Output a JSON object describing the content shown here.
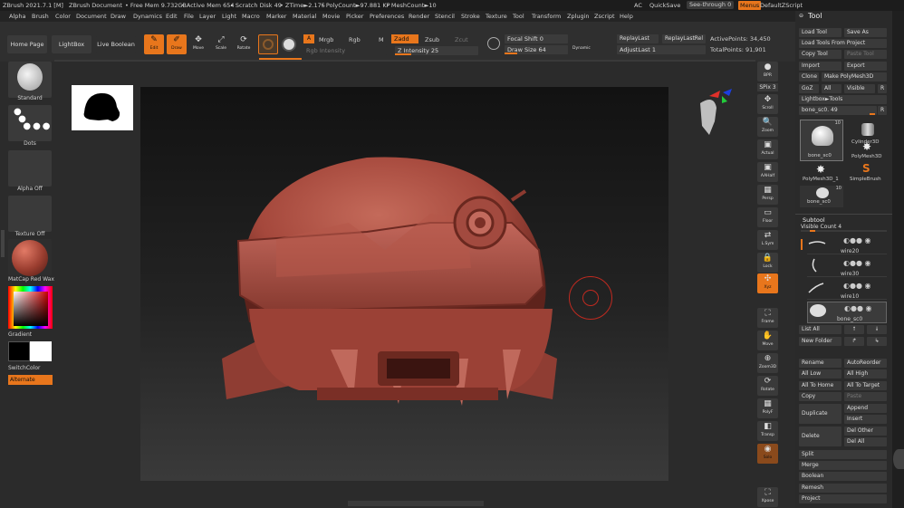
{
  "menubar": {
    "app_title": "ZBrush 2021.7.1 [M]",
    "document": "ZBrush Document",
    "stats": [
      "• Free Mem 9.732GB",
      "• Active Mem 654",
      "• Scratch Disk 49",
      "• ZTime►2.175",
      "• PolyCount►97.881 KP",
      "• MeshCount►10"
    ],
    "ac": "AC",
    "quicksave": "QuickSave",
    "seethrough": "See-through  0",
    "menus": "Menus",
    "script": "DefaultZScript",
    "items": [
      "Alpha",
      "Brush",
      "Color",
      "Document",
      "Draw",
      "Dynamics",
      "Edit",
      "File",
      "Layer",
      "Light",
      "Macro",
      "Marker",
      "Material",
      "Movie",
      "Picker",
      "Preferences",
      "Render",
      "Stencil",
      "Stroke",
      "Texture",
      "Tool",
      "Transform",
      "Zplugin",
      "Zscript",
      "Help"
    ]
  },
  "shelf": {
    "home_page": "Home Page",
    "lightbox": "LightBox",
    "live_boolean": "Live Boolean",
    "tools": [
      {
        "label": "Edit",
        "glyph": "✎",
        "active": true
      },
      {
        "label": "Draw",
        "glyph": "✐",
        "active": true
      },
      {
        "label": "Move",
        "glyph": "✥",
        "active": false
      },
      {
        "label": "Scale",
        "glyph": "⤢",
        "active": false
      },
      {
        "label": "Rotate",
        "glyph": "⟳",
        "active": false
      }
    ],
    "a_btn": "A",
    "mrgb": "Mrgb",
    "rgb": "Rgb",
    "m": "M",
    "rgb_intensity": "Rgb Intensity",
    "zadd": "Zadd",
    "zsub": "Zsub",
    "zcut": "Zcut",
    "z_intensity": "Z Intensity 25",
    "focal_shift": "Focal Shift 0",
    "draw_size": "Draw Size 64",
    "dynamic": "Dynamic",
    "replay_last": "ReplayLast",
    "replay_last_rel": "ReplayLastRel",
    "adjust_last": "AdjustLast  1",
    "active_points": "ActivePoints: 34,450",
    "total_points": "TotalPoints: 91,901"
  },
  "leftshelf": {
    "brush": "Standard",
    "stroke": "Dots",
    "alpha": "Alpha Off",
    "texture": "Texture Off",
    "material": "MatCap Red Wax",
    "gradient": "Gradient",
    "switchcolor": "SwitchColor",
    "alternate": "Alternate"
  },
  "rightshelf": [
    {
      "label": "BPR",
      "glyph": "●"
    },
    {
      "label": "SPix 3",
      "glyph": ""
    },
    {
      "label": "Scroll",
      "glyph": "✥"
    },
    {
      "label": "Zoom",
      "glyph": "🔍"
    },
    {
      "label": "Actual",
      "glyph": "▣"
    },
    {
      "label": "AAHalf",
      "glyph": "▣"
    },
    {
      "label": "Persp",
      "glyph": "▦"
    },
    {
      "label": "Floor",
      "glyph": "▭"
    },
    {
      "label": "L.Sym",
      "glyph": "⇄"
    },
    {
      "label": "Lock",
      "glyph": "🔒"
    },
    {
      "label": "Xyz",
      "glyph": "✣"
    },
    {
      "label": "Frame",
      "glyph": "⛶"
    },
    {
      "label": "Move",
      "glyph": "✋"
    },
    {
      "label": "Zoom3D",
      "glyph": "⊕"
    },
    {
      "label": "Rotate",
      "glyph": "⟳"
    },
    {
      "label": "PolyF",
      "glyph": "▦"
    },
    {
      "label": "Transp",
      "glyph": "◧"
    },
    {
      "label": "Solo",
      "glyph": "◉"
    },
    {
      "label": "Xpose",
      "glyph": "⛶"
    }
  ],
  "tool": {
    "title": "Tool",
    "load_tool": "Load Tool",
    "save_as": "Save As",
    "load_from_project": "Load Tools From Project",
    "copy_tool": "Copy Tool",
    "paste_tool": "Paste Tool",
    "import": "Import",
    "export": "Export",
    "clone": "Clone",
    "make_polymesh": "Make PolyMesh3D",
    "goz": "GoZ",
    "all": "All",
    "visible": "Visible",
    "r": "R",
    "lightbox_tools": "Lightbox►Tools",
    "current_tool": "bone_sc0. 49",
    "thumbs": [
      {
        "label": "bone_sc0",
        "count": "10"
      },
      {
        "label": "Cylinder3D",
        "count": ""
      },
      {
        "label": "PolyMesh3D",
        "count": ""
      },
      {
        "label": "PolyMesh3D_1",
        "count": ""
      },
      {
        "label": "SimpleBrush",
        "count": ""
      },
      {
        "label": "bone_sc0",
        "count": "10"
      }
    ],
    "subtool": "Subtool",
    "visible_count": "Visible Count 4",
    "subtools": [
      "wire20",
      "wire30",
      "wire10",
      "bone_sc0"
    ],
    "list_all": "List All",
    "new_folder": "New Folder",
    "rename": "Rename",
    "auto_reorder": "AutoReorder",
    "all_low": "All Low",
    "all_high": "All High",
    "all_to_home": "All To Home",
    "all_to_target": "All To Target",
    "copy": "Copy",
    "paste": "Paste",
    "duplicate": "Duplicate",
    "append": "Append",
    "insert": "Insert",
    "delete": "Delete",
    "del_other": "Del Other",
    "del_all": "Del All",
    "split": "Split",
    "merge": "Merge",
    "boolean": "Boolean",
    "remesh": "Remesh",
    "project": "Project"
  },
  "colors": {
    "accent": "#e8761c",
    "model": "#a5483c",
    "canvas_top": "#121212"
  }
}
